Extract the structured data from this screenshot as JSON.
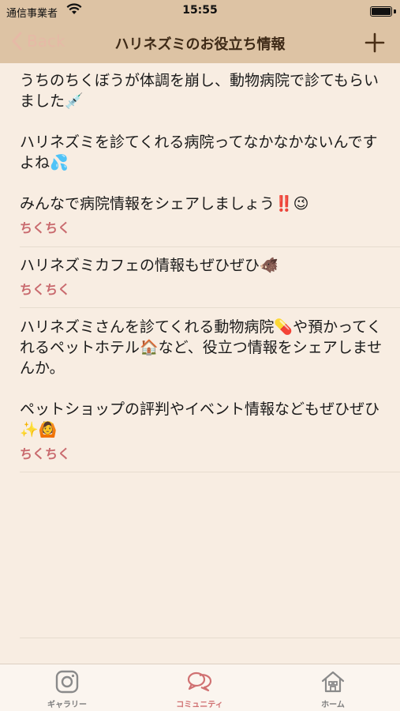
{
  "status_bar": {
    "carrier": "通信事業者",
    "time": "15:55"
  },
  "nav": {
    "back_label": "Back",
    "title": "ハリネズミのお役立ち情報"
  },
  "posts": [
    {
      "text": "うちのちくぼうが体調を崩し、動物病院で診てもらいました💉\n\nハリネズミを診てくれる病院ってなかなかないんですよね💦\n\nみんなで病院情報をシェアしましょう‼️😉",
      "author": "ちくちく"
    },
    {
      "text": "ハリネズミカフェの情報もぜひぜひ🐗",
      "author": "ちくちく"
    },
    {
      "text": "ハリネズミさんを診てくれる動物病院💊や預かってくれるペットホテル🏠など、役立つ情報をシェアしませんか。\n\nペットショップの評判やイベント情報などもぜひぜひ✨🙆",
      "author": "ちくちく"
    }
  ],
  "tabs": [
    {
      "label": "ギャラリー",
      "icon": "instagram-icon",
      "active": false
    },
    {
      "label": "コミュニティ",
      "icon": "chat-bubbles-icon",
      "active": true
    },
    {
      "label": "ホーム",
      "icon": "home-icon",
      "active": false
    }
  ],
  "colors": {
    "header_bg": "#ddc3a4",
    "page_bg": "#f8ede2",
    "accent": "#d07172",
    "author": "#c96a6e"
  }
}
